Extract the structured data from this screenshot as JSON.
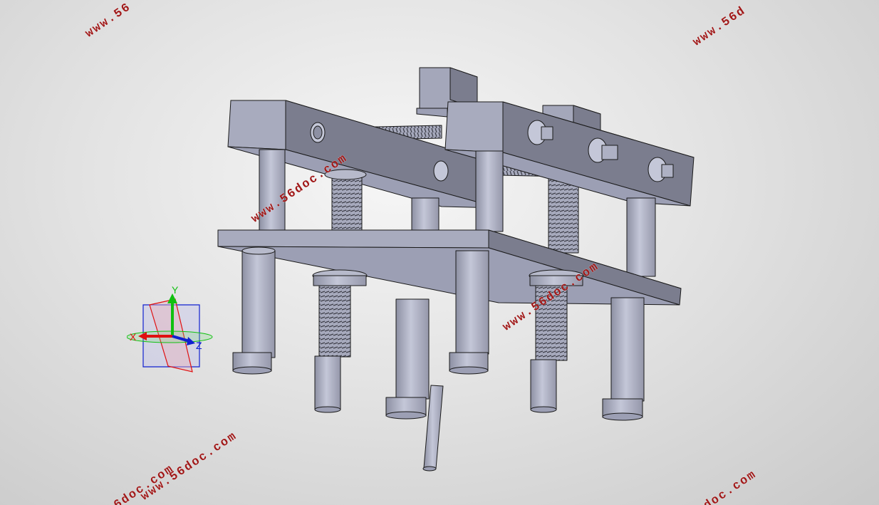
{
  "watermark": {
    "text_1": "www.56",
    "text_2": "www.56d",
    "text_3": "www.56doc.com",
    "text_4": "www.56doc.com",
    "text_5": "www.56doc.com",
    "text_6": "6doc.com",
    "text_7": "doc.com",
    "color": "#a01818"
  },
  "triad": {
    "x_label": "X",
    "y_label": "Y",
    "z_label": "Z",
    "x_color": "#e01010",
    "y_color": "#10c010",
    "z_color": "#1020d0"
  },
  "colors": {
    "background_center": "#f6f6f6",
    "background_edge": "#c9c9c9",
    "part_light": "#aeb1c4",
    "part_mid": "#9c9fb4",
    "part_dark": "#7b7d8e",
    "edge": "#1a1a1a"
  }
}
